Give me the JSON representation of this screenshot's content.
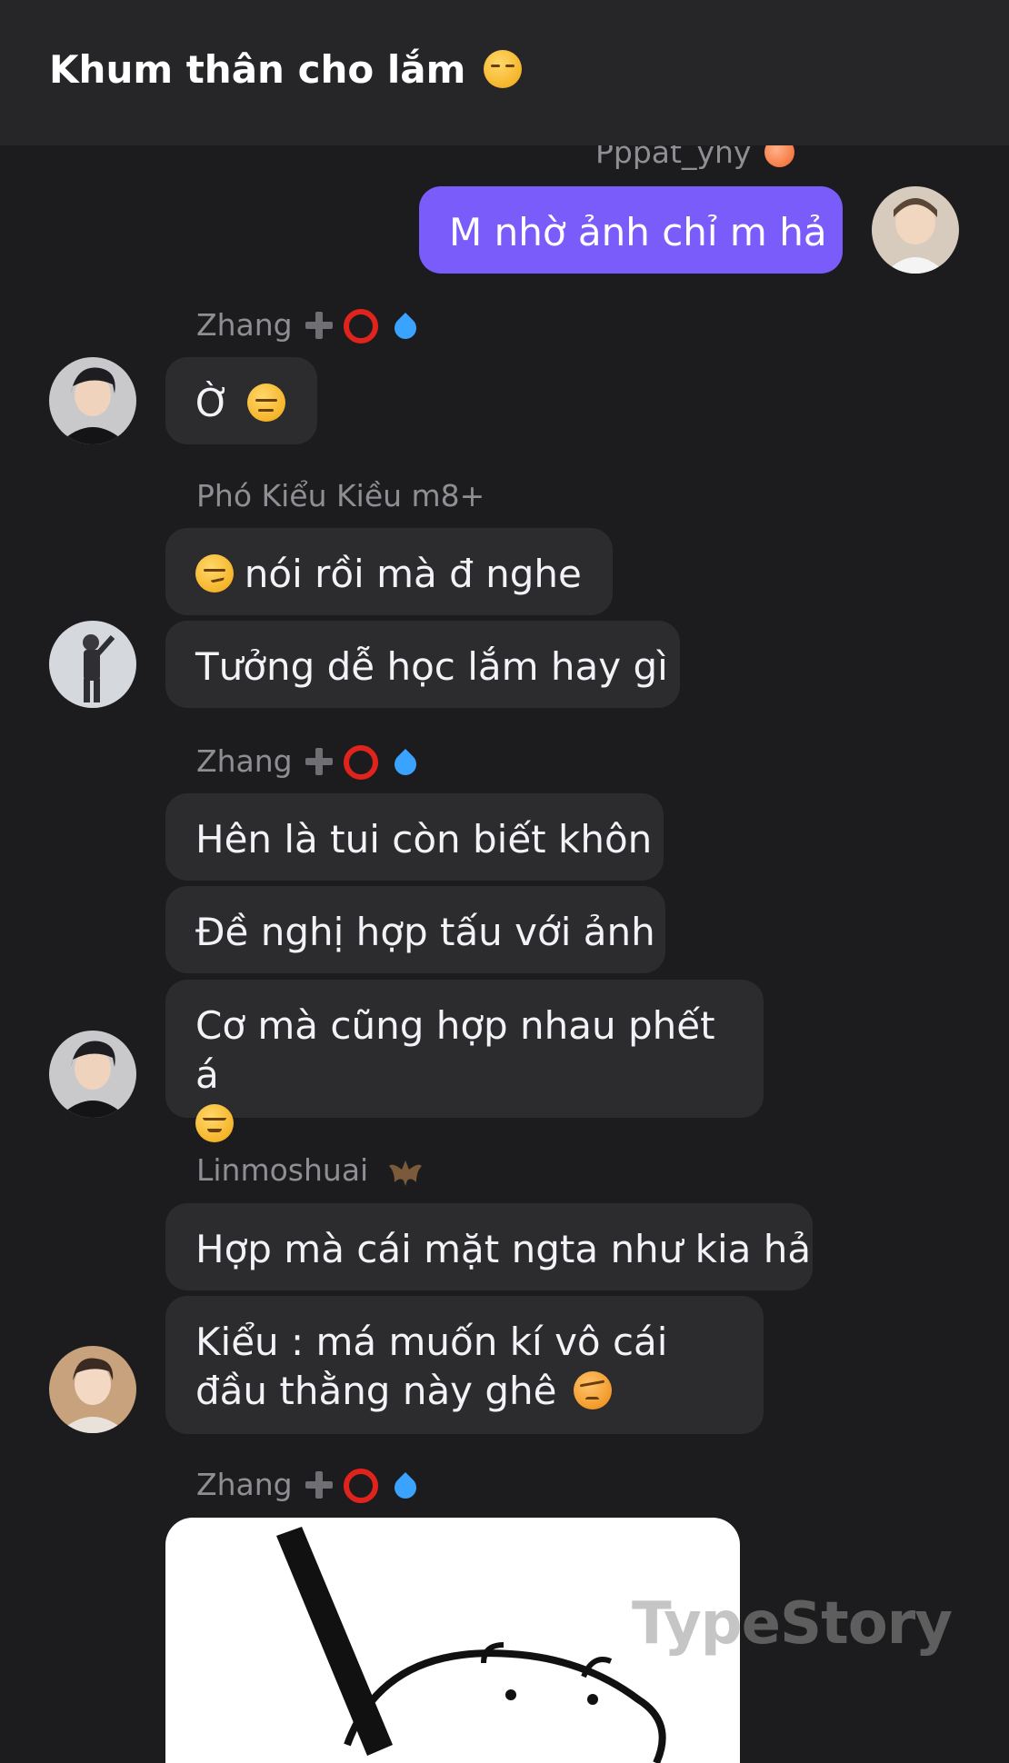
{
  "header": {
    "title": "Khum thân cho lắm",
    "title_emoji": "unamused-face-icon"
  },
  "messages": {
    "m1": {
      "sender": "Pppat_yhy",
      "text": "M nhờ ảnh chỉ m hả"
    },
    "m2": {
      "sender": "Zhang",
      "text": "Ờ"
    },
    "m3": {
      "sender": "Phó Kiểu Kiều m8+",
      "text1": "nói rồi mà đ nghe",
      "text2": "Tưởng dễ học lắm hay gì"
    },
    "m4": {
      "sender": "Zhang",
      "text1": "Hên là tui còn biết khôn",
      "text2": "Đề nghị hợp tấu với ảnh",
      "text3": "Cơ mà cũng hợp nhau phết á"
    },
    "m5": {
      "sender": "Linmoshuai",
      "text1": "Hợp mà cái mặt ngta như kia hả",
      "text2": "Kiểu : má muốn kí vô cái đầu thằng này ghê"
    },
    "m6": {
      "sender": "Zhang"
    }
  },
  "watermark": "TypeStory",
  "colors": {
    "background": "#1c1c1e",
    "header": "#262628",
    "bubble_incoming": "#2c2c2e",
    "bubble_outgoing": "#7a5cfa",
    "sender_name": "#8e8e93"
  }
}
